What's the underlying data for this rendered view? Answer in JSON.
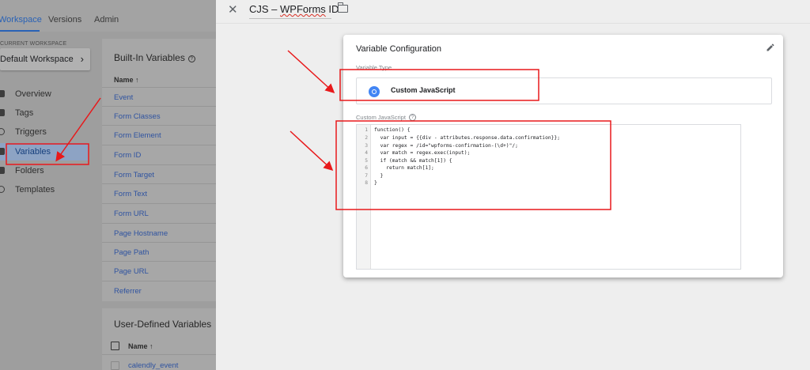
{
  "topnav": {
    "tabs": [
      "Workspace",
      "Versions",
      "Admin"
    ]
  },
  "workspace": {
    "label": "CURRENT WORKSPACE",
    "name": "Default Workspace"
  },
  "nav": {
    "items": [
      "Overview",
      "Tags",
      "Triggers",
      "Variables",
      "Folders",
      "Templates"
    ]
  },
  "builtin": {
    "title": "Built-In Variables",
    "col_name": "Name ↑",
    "rows": [
      "Event",
      "Form Classes",
      "Form Element",
      "Form ID",
      "Form Target",
      "Form Text",
      "Form URL",
      "Page Hostname",
      "Page Path",
      "Page URL",
      "Referrer"
    ]
  },
  "userdefined": {
    "title": "User-Defined Variables",
    "col_name": "Name ↑",
    "first_row": "calendly_event"
  },
  "panel": {
    "title_prefix": "CJS – ",
    "title_squig": "WPForms",
    "title_suffix": " ID",
    "card_title": "Variable Configuration",
    "variable_type_label": "Variable Type",
    "variable_type_value": "Custom JavaScript",
    "custom_js_label": "Custom JavaScript",
    "line_numbers": [
      "1",
      "2",
      "3",
      "4",
      "5",
      "6",
      "7",
      "8"
    ],
    "code_lines": [
      "function() {",
      "  var input = {{div - attributes.response.data.confirmation}};",
      "  var regex = /id=\"wpforms-confirmation-(\\d+)\"/;",
      "  var match = regex.exec(input);",
      "  if (match && match[1]) {",
      "    return match[1];",
      "  }",
      "}"
    ]
  },
  "colors": {
    "accent": "#1a73e8",
    "annotation": "#e8191b",
    "dim": "#9e9e9e"
  }
}
